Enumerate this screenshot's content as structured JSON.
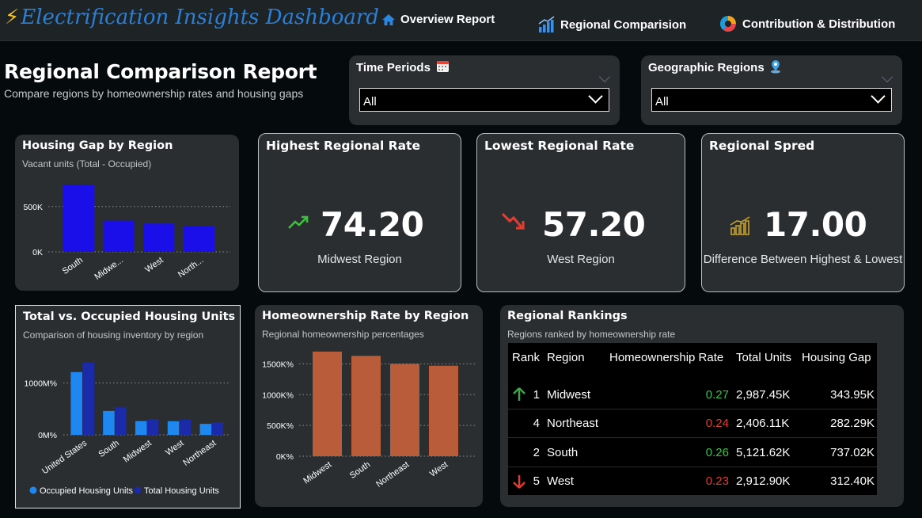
{
  "header": {
    "title": "Electrification Insights Dashboard",
    "nav": [
      {
        "label": "Overview Report",
        "icon": "home-icon"
      },
      {
        "label": "Regional Comparision",
        "icon": "bar-growth-icon"
      },
      {
        "label": "Contribution & Distribution",
        "icon": "donut-chart-icon"
      }
    ]
  },
  "page": {
    "title": "Regional Comparison Report",
    "subtitle": "Compare regions by homeownership rates and housing gaps"
  },
  "filters": {
    "time": {
      "label": "Time Periods",
      "icon": "calendar-icon",
      "value": "All"
    },
    "geo": {
      "label": "Geographic Regions",
      "icon": "location-pin-icon",
      "value": "All"
    }
  },
  "kpis": {
    "highest": {
      "title": "Highest Regional Rate",
      "value": "74.20",
      "caption": "Midwest Region",
      "icon": "trend-up-icon",
      "color": "#3fbf3f"
    },
    "lowest": {
      "title": "Lowest Regional Rate",
      "value": "57.20",
      "caption": "West Region",
      "icon": "trend-down-icon",
      "color": "#e03c31"
    },
    "spread": {
      "title": "Regional Spred",
      "value": "17.00",
      "caption": "Difference Between Highest & Lowest",
      "icon": "growth-chart-icon",
      "color": "#c9a227"
    }
  },
  "charts": {
    "housing_gap": {
      "title": "Housing Gap by Region",
      "subtitle": "Vacant units (Total - Occupied)"
    },
    "total_occupied": {
      "title": "Total vs. Occupied Housing Units",
      "subtitle": "Comparison of housing inventory by region"
    },
    "homeownership": {
      "title": "Homeownership Rate by Region",
      "subtitle": "Regional homeownership percentages"
    }
  },
  "chart_data": [
    {
      "id": "housing_gap",
      "type": "bar",
      "categories": [
        "South",
        "Midwe...",
        "West",
        "North..."
      ],
      "values": [
        737,
        344,
        312,
        282
      ],
      "unit": "K",
      "yticks": [
        "0K",
        "500K"
      ],
      "ylim": [
        0,
        900
      ],
      "color": "#1a0fe8",
      "grid": true
    },
    {
      "id": "total_occupied",
      "type": "bar",
      "categories": [
        "United States",
        "South",
        "Midwest",
        "West",
        "Northeast"
      ],
      "series": [
        {
          "name": "Occupied Housing Units",
          "values": [
            1210,
            460,
            265,
            262,
            212
          ],
          "color": "#1e88f0"
        },
        {
          "name": "Total Housing Units",
          "values": [
            1390,
            530,
            300,
            290,
            240
          ],
          "color": "#1a2aa8"
        }
      ],
      "yticks": [
        "0M%",
        "1000M%"
      ],
      "ylim": [
        0,
        1650
      ],
      "legend": "bottom",
      "grid": true
    },
    {
      "id": "homeownership",
      "type": "bar",
      "categories": [
        "Midwest",
        "South",
        "Northeast",
        "West"
      ],
      "values": [
        1700,
        1630,
        1500,
        1470
      ],
      "yticks": [
        "0K%",
        "500K%",
        "1000K%",
        "1500K%"
      ],
      "ylim": [
        0,
        1750
      ],
      "color": "#b85c3a",
      "grid": true
    }
  ],
  "rankings": {
    "title": "Regional Rankings",
    "subtitle": "Regions ranked by homeownership rate",
    "columns": [
      "Rank",
      "Region",
      "Homeownership Rate",
      "Total Units",
      "Housing Gap"
    ],
    "rows": [
      {
        "arrow": "up",
        "rank": "1",
        "region": "Midwest",
        "rate": "0.27",
        "rate_color": "#35c24a",
        "units": "2,987.45K",
        "gap": "343.95K"
      },
      {
        "arrow": "",
        "rank": "4",
        "region": "Northeast",
        "rate": "0.24",
        "rate_color": "#e03c31",
        "units": "2,406.11K",
        "gap": "282.29K"
      },
      {
        "arrow": "",
        "rank": "2",
        "region": "South",
        "rate": "0.26",
        "rate_color": "#35c24a",
        "units": "5,121.62K",
        "gap": "737.02K"
      },
      {
        "arrow": "down",
        "rank": "5",
        "region": "West",
        "rate": "0.23",
        "rate_color": "#e03c31",
        "units": "2,912.90K",
        "gap": "312.40K"
      }
    ]
  }
}
